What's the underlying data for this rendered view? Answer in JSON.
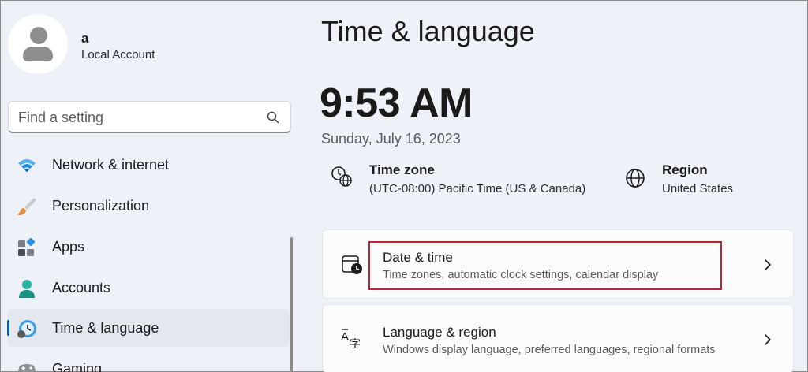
{
  "user": {
    "name": "a",
    "account_type": "Local Account"
  },
  "search": {
    "placeholder": "Find a setting"
  },
  "nav": {
    "items": [
      {
        "label": "Network & internet",
        "icon": "wifi-icon"
      },
      {
        "label": "Personalization",
        "icon": "brush-icon"
      },
      {
        "label": "Apps",
        "icon": "apps-icon"
      },
      {
        "label": "Accounts",
        "icon": "account-icon"
      },
      {
        "label": "Time & language",
        "icon": "clock-globe-icon",
        "selected": true
      },
      {
        "label": "Gaming",
        "icon": "gamepad-icon"
      }
    ]
  },
  "page": {
    "title": "Time & language",
    "time": "9:53 AM",
    "date": "Sunday, July 16, 2023"
  },
  "info": {
    "timezone": {
      "title": "Time zone",
      "value": "(UTC-08:00) Pacific Time (US & Canada)",
      "icon": "timezone-icon"
    },
    "region": {
      "title": "Region",
      "value": "United States",
      "icon": "globe-icon"
    }
  },
  "cards": [
    {
      "title": "Date & time",
      "subtitle": "Time zones, automatic clock settings, calendar display",
      "icon": "calendar-clock-icon",
      "highlighted": true
    },
    {
      "title": "Language & region",
      "subtitle": "Windows display language, preferred languages, regional formats",
      "icon": "language-icon"
    }
  ],
  "colors": {
    "background": "#eef2f8",
    "accent": "#005fb8",
    "highlight_border": "#b22a35",
    "card": "#fbfbfc"
  }
}
